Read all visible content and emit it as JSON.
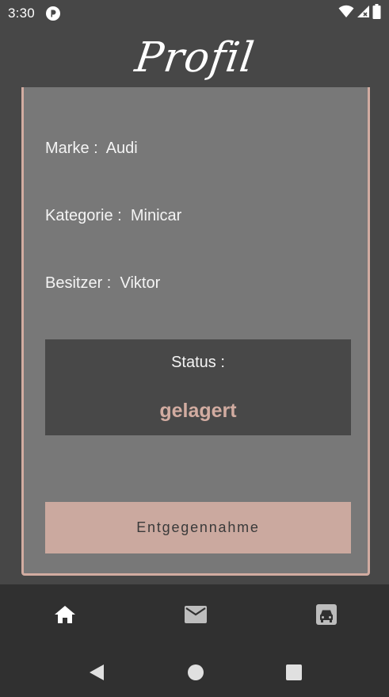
{
  "status_bar": {
    "time": "3:30",
    "icons": [
      "app-notification-icon",
      "wifi-icon",
      "cellular-signal-icon",
      "battery-icon"
    ]
  },
  "header": {
    "title": "Profil"
  },
  "profile": {
    "brand": "Marke :  Audi",
    "category": "Kategorie :  Minicar",
    "owner": "Besitzer :  Viktor"
  },
  "status": {
    "label": "Status :",
    "value": "gelagert",
    "value_color": "#d2aca1"
  },
  "action": {
    "label": "Entgegennahme",
    "color": "#cba99f"
  },
  "bottom_nav": {
    "items": [
      "home-icon",
      "mail-icon",
      "car-icon"
    ],
    "selected": "home-icon"
  },
  "system_nav": [
    "back-icon",
    "home-circle-icon",
    "recents-icon"
  ],
  "colors": {
    "background": "#474747",
    "card": "#787878",
    "accent": "#d2aca1",
    "nav_bar": "#303030"
  }
}
